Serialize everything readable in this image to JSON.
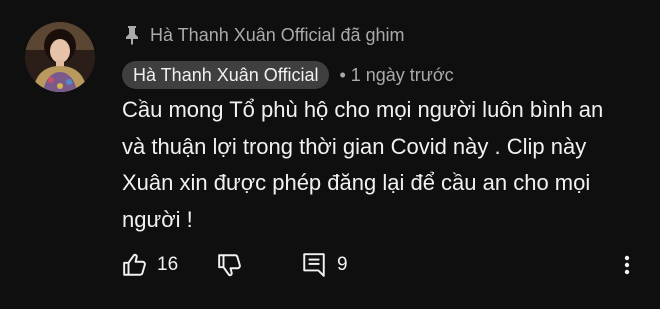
{
  "pinned": {
    "icon": "pin-icon",
    "text": "Hà Thanh Xuân Official đã ghim"
  },
  "author": {
    "name": "Hà Thanh Xuân Official",
    "avatar": "avatar-image"
  },
  "meta": {
    "time": "• 1 ngày trước"
  },
  "comment": {
    "text": "Cầu mong Tổ phù hộ cho mọi người luôn bình an và thuận lợi trong thời gian Covid này . Clip này Xuân xin được phép đăng lại để cầu an cho mọi người !"
  },
  "actions": {
    "like_icon": "thumbs-up-icon",
    "like_count": "16",
    "dislike_icon": "thumbs-down-icon",
    "reply_icon": "reply-comment-icon",
    "reply_count": "9",
    "more_icon": "more-vertical-icon"
  },
  "colors": {
    "background": "#0f0f0f",
    "text_primary": "#f1f1f1",
    "text_secondary": "#aaaaaa",
    "author_chip": "#3f3f3f"
  }
}
